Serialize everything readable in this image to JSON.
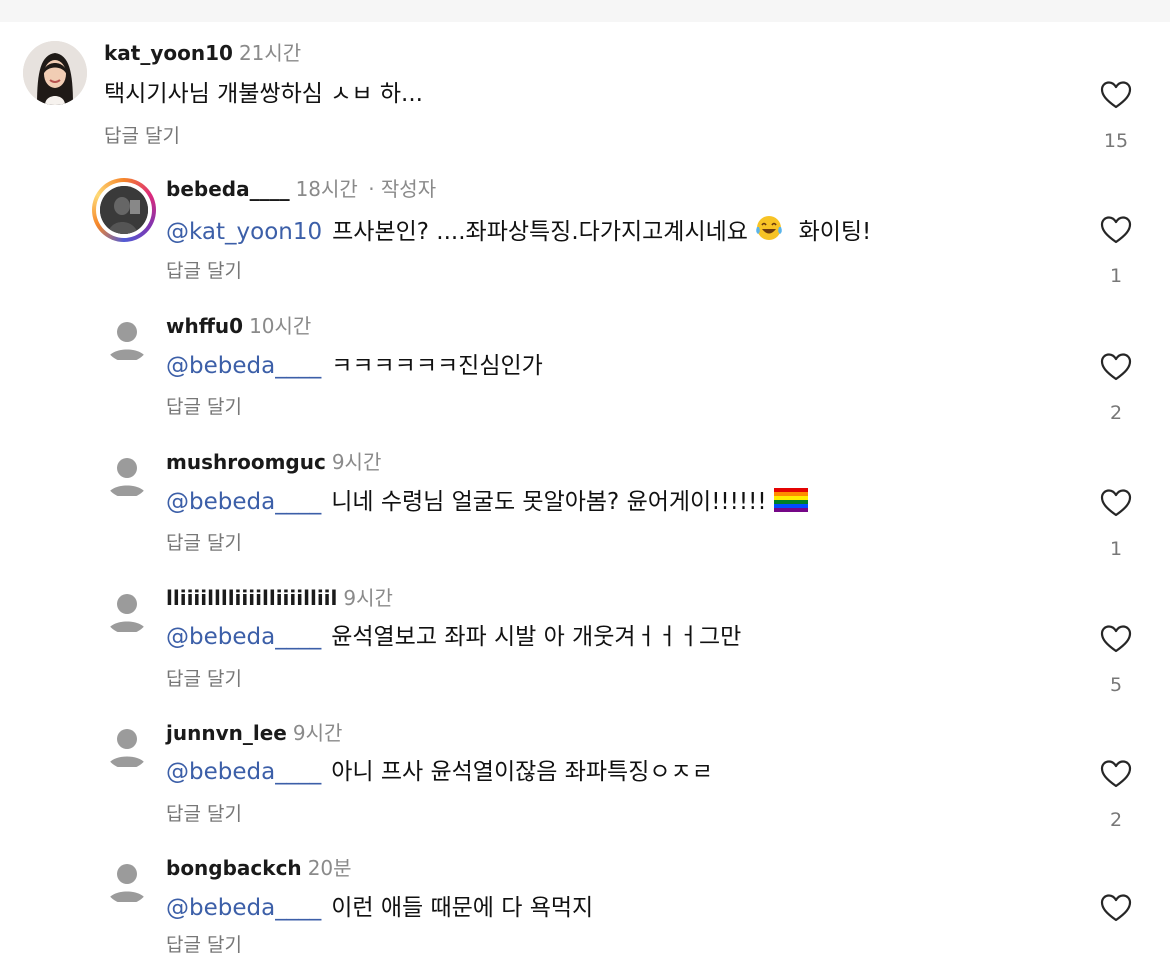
{
  "comments": [
    {
      "username": "kat_yoon10",
      "time": "21시간",
      "author_tag": "",
      "mention": "",
      "text": "택시기사님 개불쌍하심 ㅅㅂ 하...",
      "reply_label": "답글 달기",
      "likes": "15",
      "avatar": "photo"
    },
    {
      "username": "bebeda____",
      "time": "18시간",
      "author_tag": "· 작성자",
      "mention": "@kat_yoon10",
      "text": "프사본인? ....좌파상특징.다가지고계시네요",
      "text_after_emoji": "화이팅!",
      "emoji": "face-with-tears-of-joy",
      "reply_label": "답글 달기",
      "likes": "1",
      "avatar": "story-ring"
    },
    {
      "username": "whffu0",
      "time": "10시간",
      "mention": "@bebeda____",
      "text": "ㅋㅋㅋㅋㅋㅋ진심인가",
      "reply_label": "답글 달기",
      "likes": "2",
      "avatar": "default"
    },
    {
      "username": "mushroomguc",
      "time": "9시간",
      "mention": "@bebeda____",
      "text": "니네 수령님 얼굴도 못알아봄? 윤어게이!!!!!!",
      "emoji": "rainbow-flag",
      "reply_label": "답글 달기",
      "likes": "1",
      "avatar": "default"
    },
    {
      "username": "lliiiilllliiiilliiiilliil",
      "time": "9시간",
      "mention": "@bebeda____",
      "text": "윤석열보고 좌파 시발 아 개웃겨ㅓㅓㅓ그만",
      "reply_label": "답글 달기",
      "likes": "5",
      "avatar": "default"
    },
    {
      "username": "junnvn_lee",
      "time": "9시간",
      "mention": "@bebeda____",
      "text": "아니 프사 윤석열이잖음 좌파특징ㅇㅈㄹ",
      "reply_label": "답글 달기",
      "likes": "2",
      "avatar": "default"
    },
    {
      "username": "bongbackch",
      "time": "20분",
      "mention": "@bebeda____",
      "text": "이런 애들 때문에 다 욕먹지",
      "reply_label": "답글 달기",
      "likes": "",
      "avatar": "default"
    }
  ],
  "colors": {
    "mention": "#3c5fa8",
    "muted": "#8a8a8a",
    "heart_outline": "#262626"
  },
  "icons": {
    "like": "heart-outline-icon",
    "default_avatar": "default-profile-icon"
  }
}
